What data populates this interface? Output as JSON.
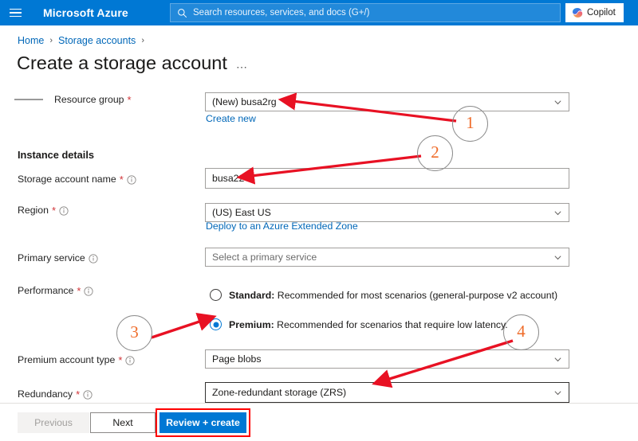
{
  "topbar": {
    "menu_icon": "hamburger-icon",
    "brand": "Microsoft Azure",
    "search": {
      "icon": "search-icon",
      "placeholder": "Search resources, services, and docs (G+/)"
    },
    "copilot": {
      "icon": "copilot-icon",
      "label": "Copilot"
    },
    "background_color": "#0078d4"
  },
  "breadcrumb": {
    "items": [
      {
        "label": "Home"
      },
      {
        "label": "Storage accounts"
      }
    ],
    "separator": "›",
    "link_color": "#0067b8"
  },
  "page": {
    "title": "Create a storage account",
    "more_actions": "⋯"
  },
  "form": {
    "resource_group": {
      "label": "Resource group",
      "required": "*",
      "value": "(New) busa2rg",
      "create_new_link": "Create new"
    },
    "instance_details_heading": "Instance details",
    "storage_account_name": {
      "label": "Storage account name",
      "required": "*",
      "info": "info-icon",
      "value": "busa22"
    },
    "region": {
      "label": "Region",
      "required": "*",
      "info": "info-icon",
      "value": "(US) East US",
      "extended_zone_link": "Deploy to an Azure Extended Zone"
    },
    "primary_service": {
      "label": "Primary service",
      "info": "info-icon",
      "placeholder": "Select a primary service"
    },
    "performance": {
      "label": "Performance",
      "required": "*",
      "info": "info-icon",
      "options": [
        {
          "id": "standard",
          "bold": "Standard:",
          "text": " Recommended for most scenarios (general-purpose v2 account)",
          "selected": false
        },
        {
          "id": "premium",
          "bold": "Premium:",
          "text": " Recommended for scenarios that require low latency.",
          "selected": true
        }
      ]
    },
    "premium_account_type": {
      "label": "Premium account type",
      "required": "*",
      "info": "info-icon",
      "value": "Page blobs"
    },
    "redundancy": {
      "label": "Redundancy",
      "required": "*",
      "info": "info-icon",
      "value": "Zone-redundant storage (ZRS)",
      "focused": true
    }
  },
  "footer": {
    "previous_label": "Previous",
    "next_label": "Next",
    "review_label": "Review + create",
    "review_accent_color": "#0078d4",
    "highlight_color": "#ff0000"
  },
  "annotations": {
    "number_color": "#ef6c2a",
    "arrow_color": "#e81123",
    "markers": [
      {
        "number": "1"
      },
      {
        "number": "2"
      },
      {
        "number": "3"
      },
      {
        "number": "4"
      }
    ]
  }
}
